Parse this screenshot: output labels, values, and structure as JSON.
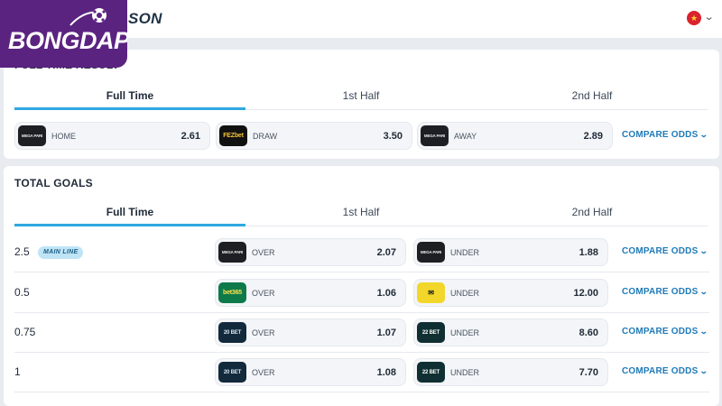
{
  "header": {
    "title_fragment": "SON",
    "logo_text": "BONGDAPI",
    "flag_icon": "vietnam-flag-icon",
    "chevron_icon": "chevron-down-icon"
  },
  "full_time_result": {
    "title": "FULL TIME RESULT",
    "tabs": [
      "Full Time",
      "1st Half",
      "2nd Half"
    ],
    "odds": [
      {
        "bookmaker": "MEGA PARI",
        "label": "HOME",
        "value": "2.61"
      },
      {
        "bookmaker": "FEZbet",
        "label": "DRAW",
        "value": "3.50"
      },
      {
        "bookmaker": "MEGA PARI",
        "label": "AWAY",
        "value": "2.89"
      }
    ],
    "compare_label": "COMPARE ODDS"
  },
  "total_goals": {
    "title": "TOTAL GOALS",
    "tabs": [
      "Full Time",
      "1st Half",
      "2nd Half"
    ],
    "main_line_badge": "MAIN LINE",
    "compare_label": "COMPARE ODDS",
    "rows": [
      {
        "line": "2.5",
        "over_bookmaker": "MEGA PARI",
        "over_label": "OVER",
        "over_value": "2.07",
        "under_bookmaker": "MEGA PARI",
        "under_label": "UNDER",
        "under_value": "1.88"
      },
      {
        "line": "0.5",
        "over_bookmaker": "bet365",
        "over_label": "OVER",
        "over_value": "1.06",
        "under_bookmaker": "✉",
        "under_label": "UNDER",
        "under_value": "12.00"
      },
      {
        "line": "0.75",
        "over_bookmaker": "20 BET",
        "over_label": "OVER",
        "over_value": "1.07",
        "under_bookmaker": "22 BET",
        "under_label": "UNDER",
        "under_value": "8.60"
      },
      {
        "line": "1",
        "over_bookmaker": "20 BET",
        "over_label": "OVER",
        "over_value": "1.08",
        "under_bookmaker": "22 BET",
        "under_label": "UNDER",
        "under_value": "7.70"
      }
    ]
  }
}
